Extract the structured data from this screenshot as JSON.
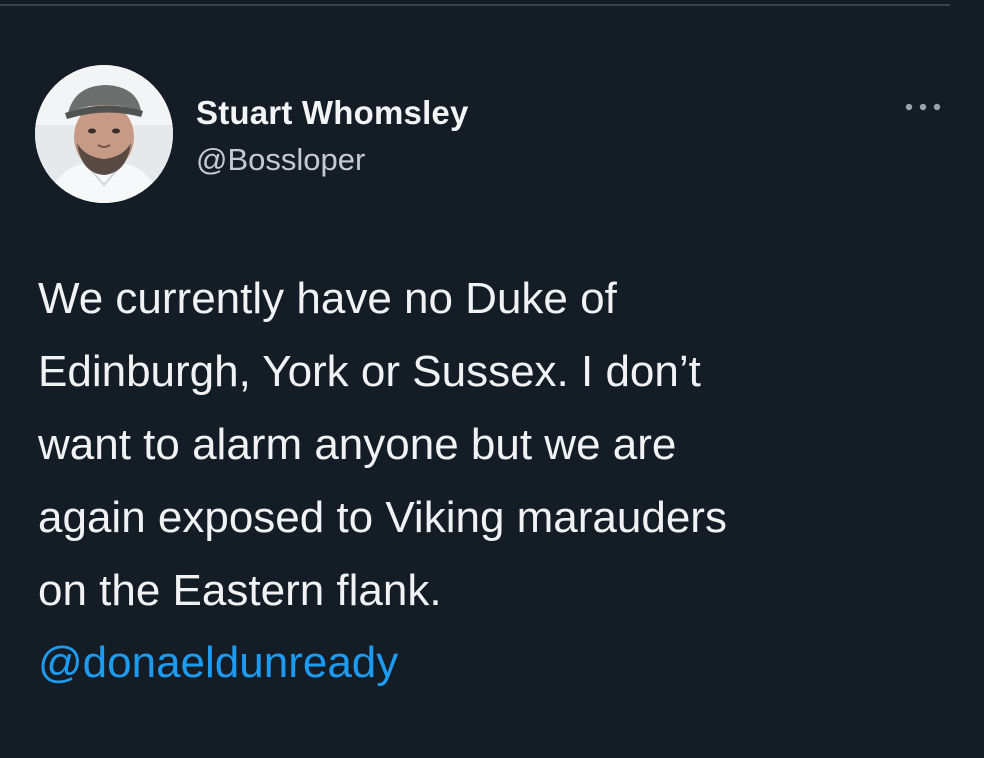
{
  "tweet": {
    "author": {
      "name": "Stuart Whomsley",
      "handle": "@Bossloper",
      "avatar_icon": "profile-photo"
    },
    "more_icon": "more-options-icon",
    "text_lines": [
      "We currently have no Duke of",
      "Edinburgh, York or Sussex. I don’t",
      "want to alarm anyone but we are",
      "again exposed to Viking marauders",
      "on the Eastern flank."
    ],
    "mention": "@donaeldunready"
  },
  "colors": {
    "background": "#141c25",
    "text": "#f0f2f3",
    "secondary_text": "#c4cad0",
    "link": "#1d9bf0"
  }
}
